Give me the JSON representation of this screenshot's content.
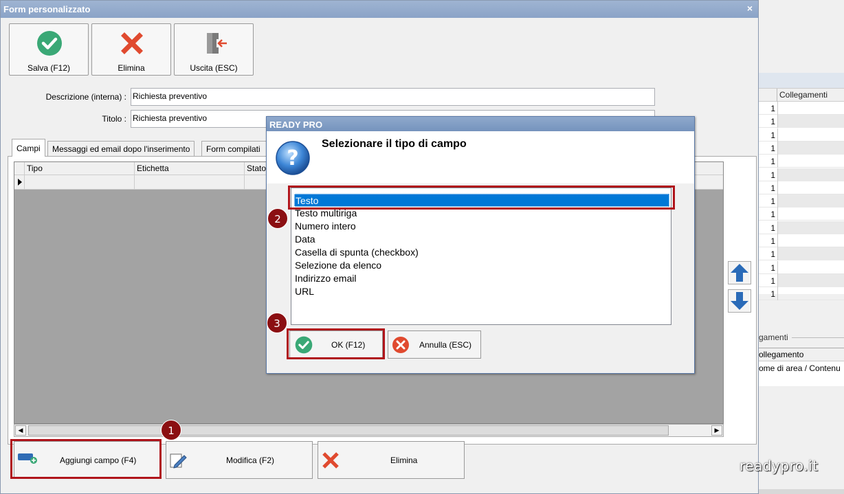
{
  "window": {
    "title": "Form personalizzato",
    "close_glyph": "×"
  },
  "toolbar": {
    "save_label": "Salva (F12)",
    "delete_label": "Elimina",
    "exit_label": "Uscita (ESC)"
  },
  "fields": {
    "description_label": "Descrizione (interna) :",
    "description_value": "Richiesta preventivo",
    "title_label": "Titolo :",
    "title_value": "Richiesta preventivo"
  },
  "tabs": [
    {
      "label": "Campi"
    },
    {
      "label": "Messaggi ed email dopo l'inserimento"
    },
    {
      "label": "Form compilati"
    }
  ],
  "grid": {
    "columns": [
      "Tipo",
      "Etichetta",
      "Stato"
    ]
  },
  "bottom_buttons": {
    "add_label": "Aggiungi campo (F4)",
    "edit_label": "Modifica (F2)",
    "delete_label": "Elimina"
  },
  "dialog": {
    "title": "READY PRO",
    "heading": "Selezionare il tipo di campo",
    "options": [
      "Testo",
      "Testo multiriga",
      "Numero intero",
      "Data",
      "Casella di spunta (checkbox)",
      "Selezione da elenco",
      "Indirizzo email",
      "URL"
    ],
    "selected": "Testo",
    "ok_label": "OK (F12)",
    "cancel_label": "Annulla (ESC)"
  },
  "background_window": {
    "column_header": "Collegamenti",
    "row_values": [
      "1",
      "1",
      "1",
      "1",
      "1",
      "1",
      "1",
      "1",
      "1",
      "1",
      "1",
      "1",
      "1",
      "1",
      "1"
    ],
    "group_label": "gamenti",
    "table_header": "ollegamento",
    "table_cell": "ome di area / Contenu"
  },
  "annotations": [
    "1",
    "2",
    "3"
  ],
  "watermark": "readypro.it",
  "colors": {
    "accent_red": "#b0141b",
    "marker_red": "#8b0f12",
    "selection_blue": "#0078d7",
    "title_bar": "#8aa3c7",
    "ok_green": "#3aa876",
    "delete_red": "#e04a2f"
  }
}
